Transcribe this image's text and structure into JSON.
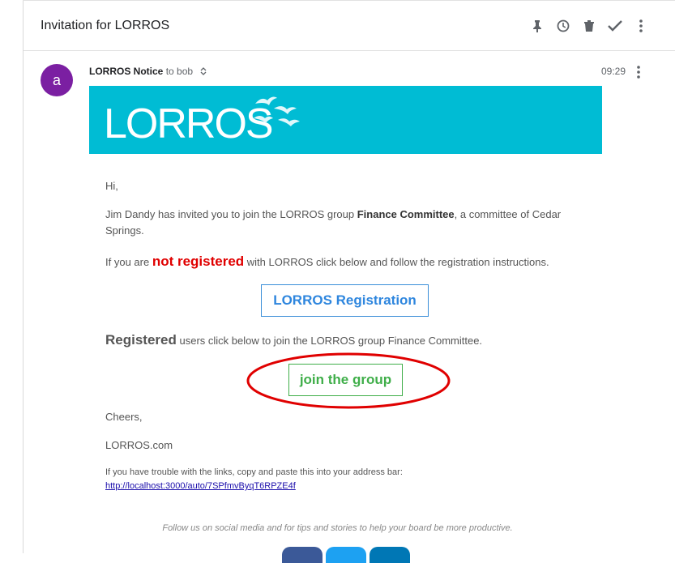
{
  "email": {
    "subject": "Invitation for LORROS",
    "toolbar": {
      "icons": [
        "pin-icon",
        "clock-icon",
        "trash-icon",
        "check-icon",
        "more-vert-icon"
      ]
    },
    "sender": {
      "avatar_letter": "a",
      "avatar_color": "#7b1fa2",
      "name": "LORROS Notice",
      "to": "to bob",
      "time": "09:29"
    }
  },
  "banner": {
    "logo_text": "LORROS",
    "color": "#00bcd4"
  },
  "content": {
    "greeting": "Hi,",
    "invite_prefix": "Jim Dandy has invited you to join the LORROS group ",
    "group_name": "Finance Committee",
    "invite_suffix": ", a committee of Cedar Springs.",
    "unreg_prefix": "If you are ",
    "unreg_highlight": "not registered",
    "unreg_suffix": " with LORROS click below and follow the registration instructions.",
    "registration_button": "LORROS Registration",
    "reg_highlight": "Registered",
    "reg_suffix": " users click below to join the LORROS group Finance Committee.",
    "join_button": "join the group",
    "cheers": "Cheers,",
    "site": "LORROS.com",
    "trouble_text": "If you have trouble with the links, copy and paste this into your address bar: ",
    "trouble_link": "http://localhost:3000/auto/7SPfmvByqT6RPZE4f",
    "footer": "Follow us on social media and for tips and stories to help your board be more productive."
  }
}
